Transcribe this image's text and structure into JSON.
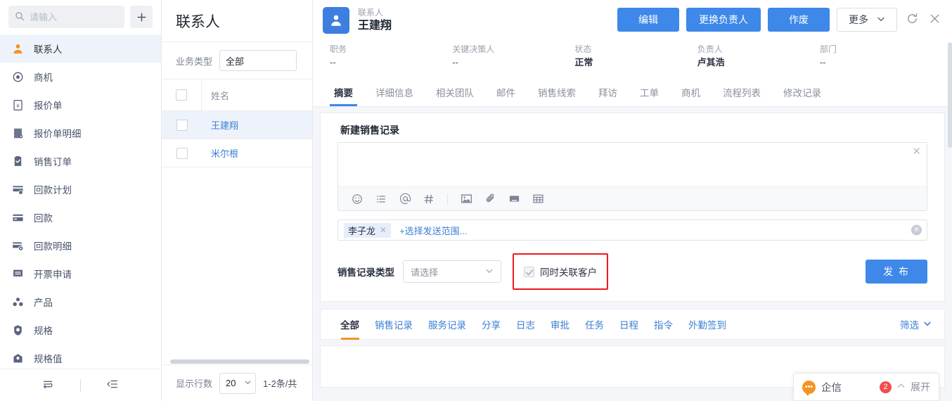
{
  "sidebar": {
    "search": {
      "placeholder": "请输入",
      "value": ""
    },
    "add_label": "+",
    "items": [
      {
        "label": "联系人",
        "icon": "contact-icon",
        "active": true
      },
      {
        "label": "商机",
        "icon": "opportunity-icon",
        "active": false
      },
      {
        "label": "报价单",
        "icon": "quote-icon",
        "active": false
      },
      {
        "label": "报价单明细",
        "icon": "quote-detail-icon",
        "active": false
      },
      {
        "label": "销售订单",
        "icon": "sales-order-icon",
        "active": false
      },
      {
        "label": "回款计划",
        "icon": "payment-plan-icon",
        "active": false
      },
      {
        "label": "回款",
        "icon": "payment-icon",
        "active": false
      },
      {
        "label": "回款明细",
        "icon": "payment-detail-icon",
        "active": false
      },
      {
        "label": "开票申请",
        "icon": "invoice-request-icon",
        "active": false
      },
      {
        "label": "产品",
        "icon": "product-icon",
        "active": false
      },
      {
        "label": "规格",
        "icon": "spec-icon",
        "active": false
      },
      {
        "label": "规格值",
        "icon": "spec-value-icon",
        "active": false
      }
    ]
  },
  "list_panel": {
    "title": "联系人",
    "filter": {
      "label": "业务类型",
      "value": "全部"
    },
    "columns": [
      "姓名"
    ],
    "rows": [
      {
        "name": "王建翔",
        "selected": true
      },
      {
        "name": "米尔根",
        "selected": false
      }
    ],
    "pager": {
      "rows_label": "显示行数",
      "page_size": "20",
      "count_text": "1-2条/共"
    }
  },
  "detail": {
    "record_kind": "联系人",
    "record_name": "王建翔",
    "actions": {
      "edit": "编辑",
      "change_owner": "更换负责人",
      "void": "作废",
      "more": "更多"
    },
    "meta": [
      {
        "key": "职务",
        "value": "--",
        "dim": true
      },
      {
        "key": "关键决策人",
        "value": "--",
        "dim": true
      },
      {
        "key": "状态",
        "value": "正常",
        "dim": false
      },
      {
        "key": "负责人",
        "value": "卢其浩",
        "dim": false
      },
      {
        "key": "部门",
        "value": "--",
        "dim": true
      }
    ],
    "tabs": [
      {
        "label": "摘要",
        "active": true
      },
      {
        "label": "详细信息",
        "active": false
      },
      {
        "label": "相关团队",
        "active": false
      },
      {
        "label": "邮件",
        "active": false
      },
      {
        "label": "销售线索",
        "active": false
      },
      {
        "label": "拜访",
        "active": false
      },
      {
        "label": "工单",
        "active": false
      },
      {
        "label": "商机",
        "active": false
      },
      {
        "label": "流程列表",
        "active": false
      },
      {
        "label": "修改记录",
        "active": false
      }
    ]
  },
  "compose": {
    "title": "新建销售记录",
    "editor_value": "",
    "toolbar_icons": [
      "emoji-icon",
      "list-icon",
      "mention-icon",
      "hashtag-icon",
      "image-icon",
      "attachment-icon",
      "card-icon",
      "table-icon"
    ],
    "recipients": [
      {
        "name": "李子龙"
      }
    ],
    "add_scope_label": "+选择发送范围...",
    "type_label": "销售记录类型",
    "type_value": "请选择",
    "link_customer_label": "同时关联客户",
    "link_customer_checked": true,
    "publish_label": "发 布",
    "highlight_color": "#ea1c1c"
  },
  "feed": {
    "tabs": [
      {
        "label": "全部",
        "active": true
      },
      {
        "label": "销售记录",
        "active": false
      },
      {
        "label": "服务记录",
        "active": false
      },
      {
        "label": "分享",
        "active": false
      },
      {
        "label": "日志",
        "active": false
      },
      {
        "label": "审批",
        "active": false
      },
      {
        "label": "任务",
        "active": false
      },
      {
        "label": "日程",
        "active": false
      },
      {
        "label": "指令",
        "active": false
      },
      {
        "label": "外勤签到",
        "active": false
      }
    ],
    "filter_label": "筛选"
  },
  "qixin": {
    "title": "企信",
    "badge": "2",
    "expand_label": "展开"
  },
  "colors": {
    "accent_blue": "#3d88e8",
    "accent_orange": "#f59324",
    "link_blue": "#3b7fd4",
    "danger_red": "#f04e4e"
  }
}
